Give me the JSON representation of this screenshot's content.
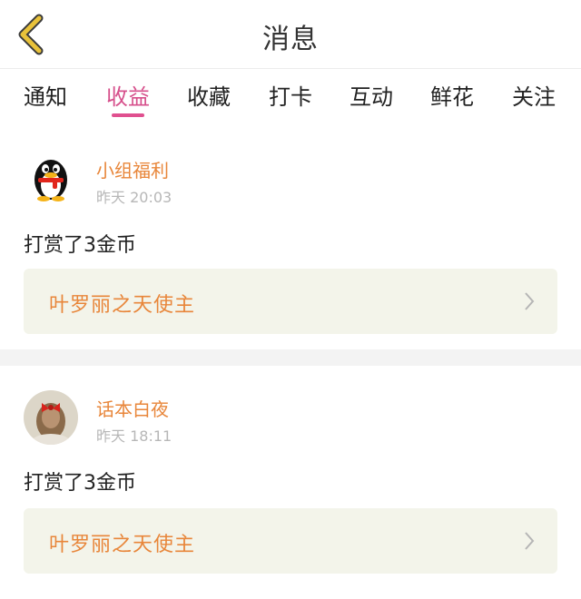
{
  "header": {
    "title": "消息",
    "back_icon": "back-chevron-icon"
  },
  "tabs": [
    {
      "label": "通知",
      "active": false
    },
    {
      "label": "收益",
      "active": true
    },
    {
      "label": "收藏",
      "active": false
    },
    {
      "label": "打卡",
      "active": false
    },
    {
      "label": "互动",
      "active": false
    },
    {
      "label": "鲜花",
      "active": false
    },
    {
      "label": "关注",
      "active": false
    }
  ],
  "messages": [
    {
      "user": "小组福利",
      "avatar": "penguin-avatar",
      "time": "昨天 20:03",
      "text": "打赏了3金币",
      "link": "叶罗丽之天使主"
    },
    {
      "user": "话本白夜",
      "avatar": "photo-avatar",
      "time": "昨天 18:11",
      "text": "打赏了3金币",
      "link": "叶罗丽之天使主"
    }
  ],
  "colors": {
    "accent": "#e0508f",
    "name": "#e8863a",
    "back_icon": "#e9c23a",
    "link_bg": "#f3f4ea"
  }
}
